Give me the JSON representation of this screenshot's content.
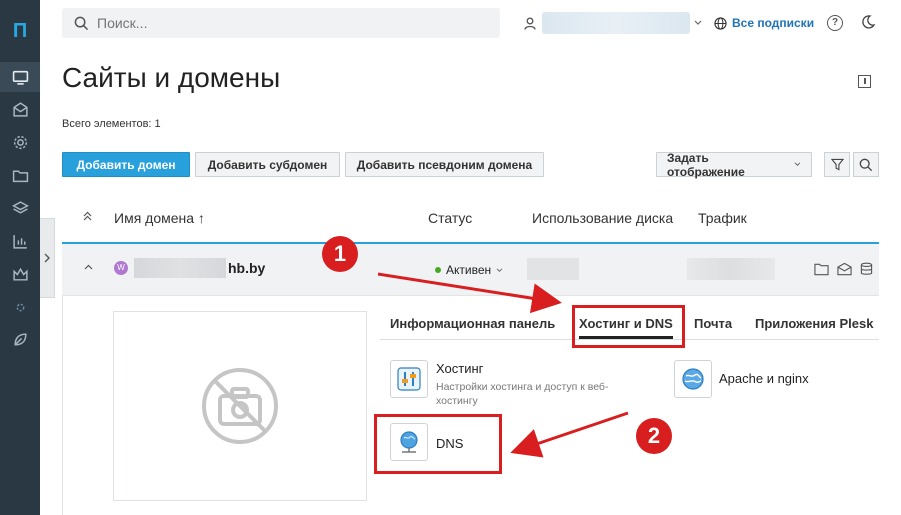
{
  "sidebar": {
    "logo": "П",
    "items": [
      {
        "icon": "monitor-icon",
        "active": true
      },
      {
        "icon": "mail-icon"
      },
      {
        "icon": "gear-icon"
      },
      {
        "icon": "folder-icon"
      },
      {
        "icon": "layers-icon"
      },
      {
        "icon": "bar-chart-icon"
      },
      {
        "icon": "crown-icon"
      },
      {
        "icon": "sparkle-icon"
      },
      {
        "icon": "leaf-icon"
      }
    ]
  },
  "topbar": {
    "search_placeholder": "Поиск...",
    "subscriptions_label": "Все подписки",
    "help_label": "?"
  },
  "page": {
    "title": "Сайты и домены",
    "total": "Всего элементов: 1"
  },
  "toolbar": {
    "add_domain": "Добавить домен",
    "add_subdomain": "Добавить субдомен",
    "add_alias": "Добавить псевдоним домена",
    "view_mode": "Задать отображение"
  },
  "table": {
    "col_domain": "Имя домена ↑",
    "col_status": "Статус",
    "col_disk": "Использование диска",
    "col_traffic": "Трафик"
  },
  "row": {
    "domain_suffix": "hb.by",
    "status": "Активен"
  },
  "tabs": {
    "dashboard": "Информационная панель",
    "hosting_dns": "Хостинг и DNS",
    "mail": "Почта",
    "apps": "Приложения Plesk"
  },
  "features": {
    "hosting_title": "Хостинг",
    "hosting_desc": "Настройки хостинга и доступ к веб-хостингу",
    "apache_title": "Apache и nginx",
    "dns_title": "DNS"
  },
  "annotations": {
    "step1": "1",
    "step2": "2"
  },
  "colors": {
    "accent": "#28a0dc",
    "sidebar": "#2a3844",
    "annotation": "#d81e1e",
    "active_status": "#49a822"
  }
}
